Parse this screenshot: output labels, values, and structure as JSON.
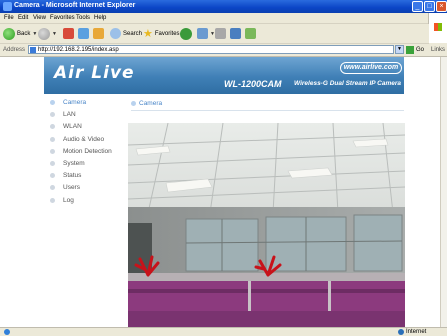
{
  "window": {
    "title": "Camera - Microsoft Internet Explorer"
  },
  "menu": [
    "File",
    "Edit",
    "View",
    "Favorites",
    "Tools",
    "Help"
  ],
  "toolbar": {
    "back": "Back",
    "search": "Search",
    "favorites": "Favorites"
  },
  "address": {
    "label": "Address",
    "url": "http://192.168.2.195/index.asp",
    "go": "Go",
    "links": "Links"
  },
  "brand": {
    "logo": "Air Live",
    "url": "www.airlive.com",
    "model": "WL-1200CAM",
    "description": "Wireless-G Dual Stream IP Camera"
  },
  "nav": [
    {
      "label": "Camera",
      "active": true
    },
    {
      "label": "LAN"
    },
    {
      "label": "WLAN"
    },
    {
      "label": "Audio & Video"
    },
    {
      "label": "Motion Detection"
    },
    {
      "label": "System"
    },
    {
      "label": "Status"
    },
    {
      "label": "Users"
    },
    {
      "label": "Log"
    }
  ],
  "content": {
    "section_title": "Camera"
  },
  "status": {
    "zone": "Internet"
  },
  "colors": {
    "accent": "#4a86c8",
    "header": "#3f7fb6",
    "xp_blue": "#0b45c6"
  }
}
